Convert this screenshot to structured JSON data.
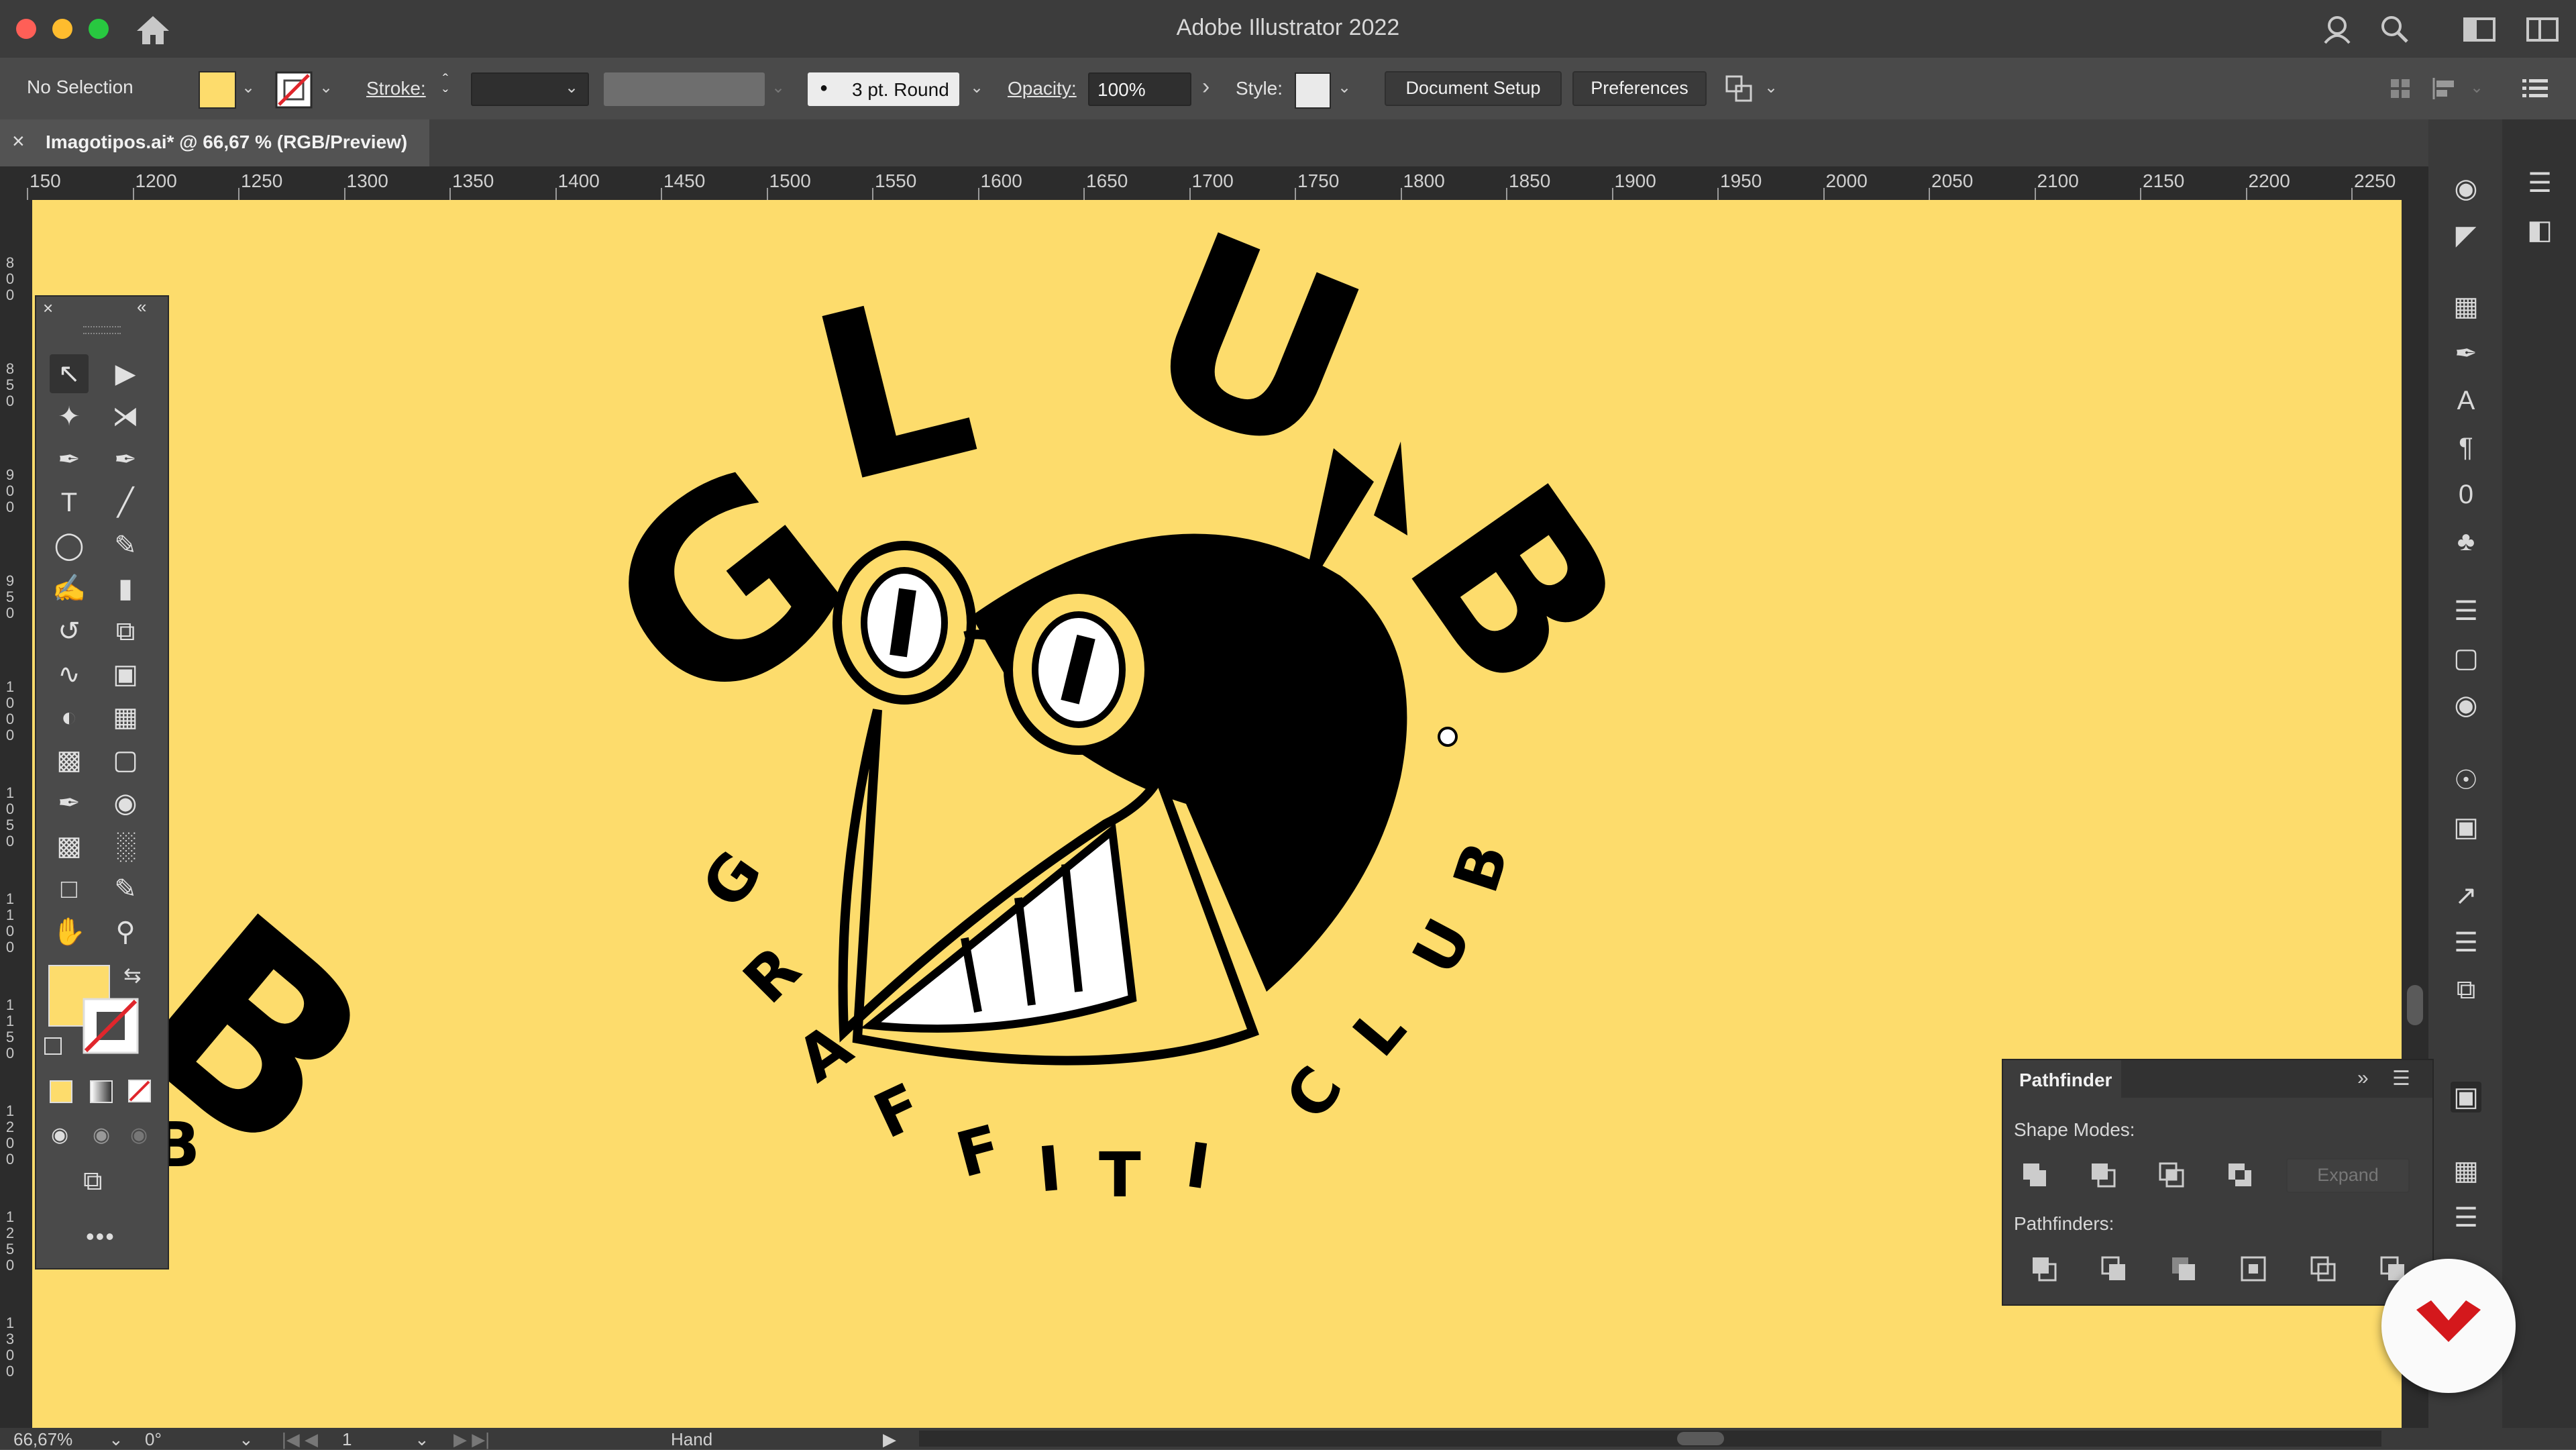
{
  "window": {
    "title": "Adobe Illustrator 2022",
    "traffic_colors": [
      "#ff5f57",
      "#febc2e",
      "#28c840"
    ]
  },
  "control_bar": {
    "selection": "No Selection",
    "fill_color": "#fddc6c",
    "stroke_label": "Stroke:",
    "brush": "3 pt. Round",
    "opacity_label": "Opacity:",
    "opacity_value": "100%",
    "style_label": "Style:",
    "document_setup": "Document Setup",
    "preferences": "Preferences"
  },
  "tab": {
    "label": "Imagotipos.ai* @ 66,67 % (RGB/Preview)"
  },
  "ruler": {
    "top_labels": [
      "150",
      "1200",
      "1250",
      "1300",
      "1350",
      "1400",
      "1450",
      "1500",
      "1550",
      "1600",
      "1650",
      "1700",
      "1750",
      "1800",
      "1850",
      "1900",
      "1950",
      "2000",
      "2050",
      "2100",
      "2150",
      "2200",
      "2250"
    ],
    "left_labels": [
      "800",
      "850",
      "900",
      "950",
      "1000",
      "1050",
      "1100",
      "1150",
      "1200",
      "1250",
      "1300"
    ]
  },
  "artwork": {
    "top_letters": [
      "G",
      "L",
      "U",
      "B"
    ],
    "bottom_letters": [
      "G",
      "R",
      "A",
      "F",
      "F",
      "I",
      "T",
      "I",
      "C",
      "L",
      "U",
      "B"
    ],
    "left_partial": "B",
    "left_partial_small": "B",
    "background": "#fddc6c"
  },
  "pathfinder": {
    "title": "Pathfinder",
    "shape_modes_label": "Shape Modes:",
    "expand_label": "Expand",
    "pathfinders_label": "Pathfinders:"
  },
  "status_bar": {
    "zoom": "66,67%",
    "rotation": "0°",
    "artboard": "1",
    "tool": "Hand"
  }
}
